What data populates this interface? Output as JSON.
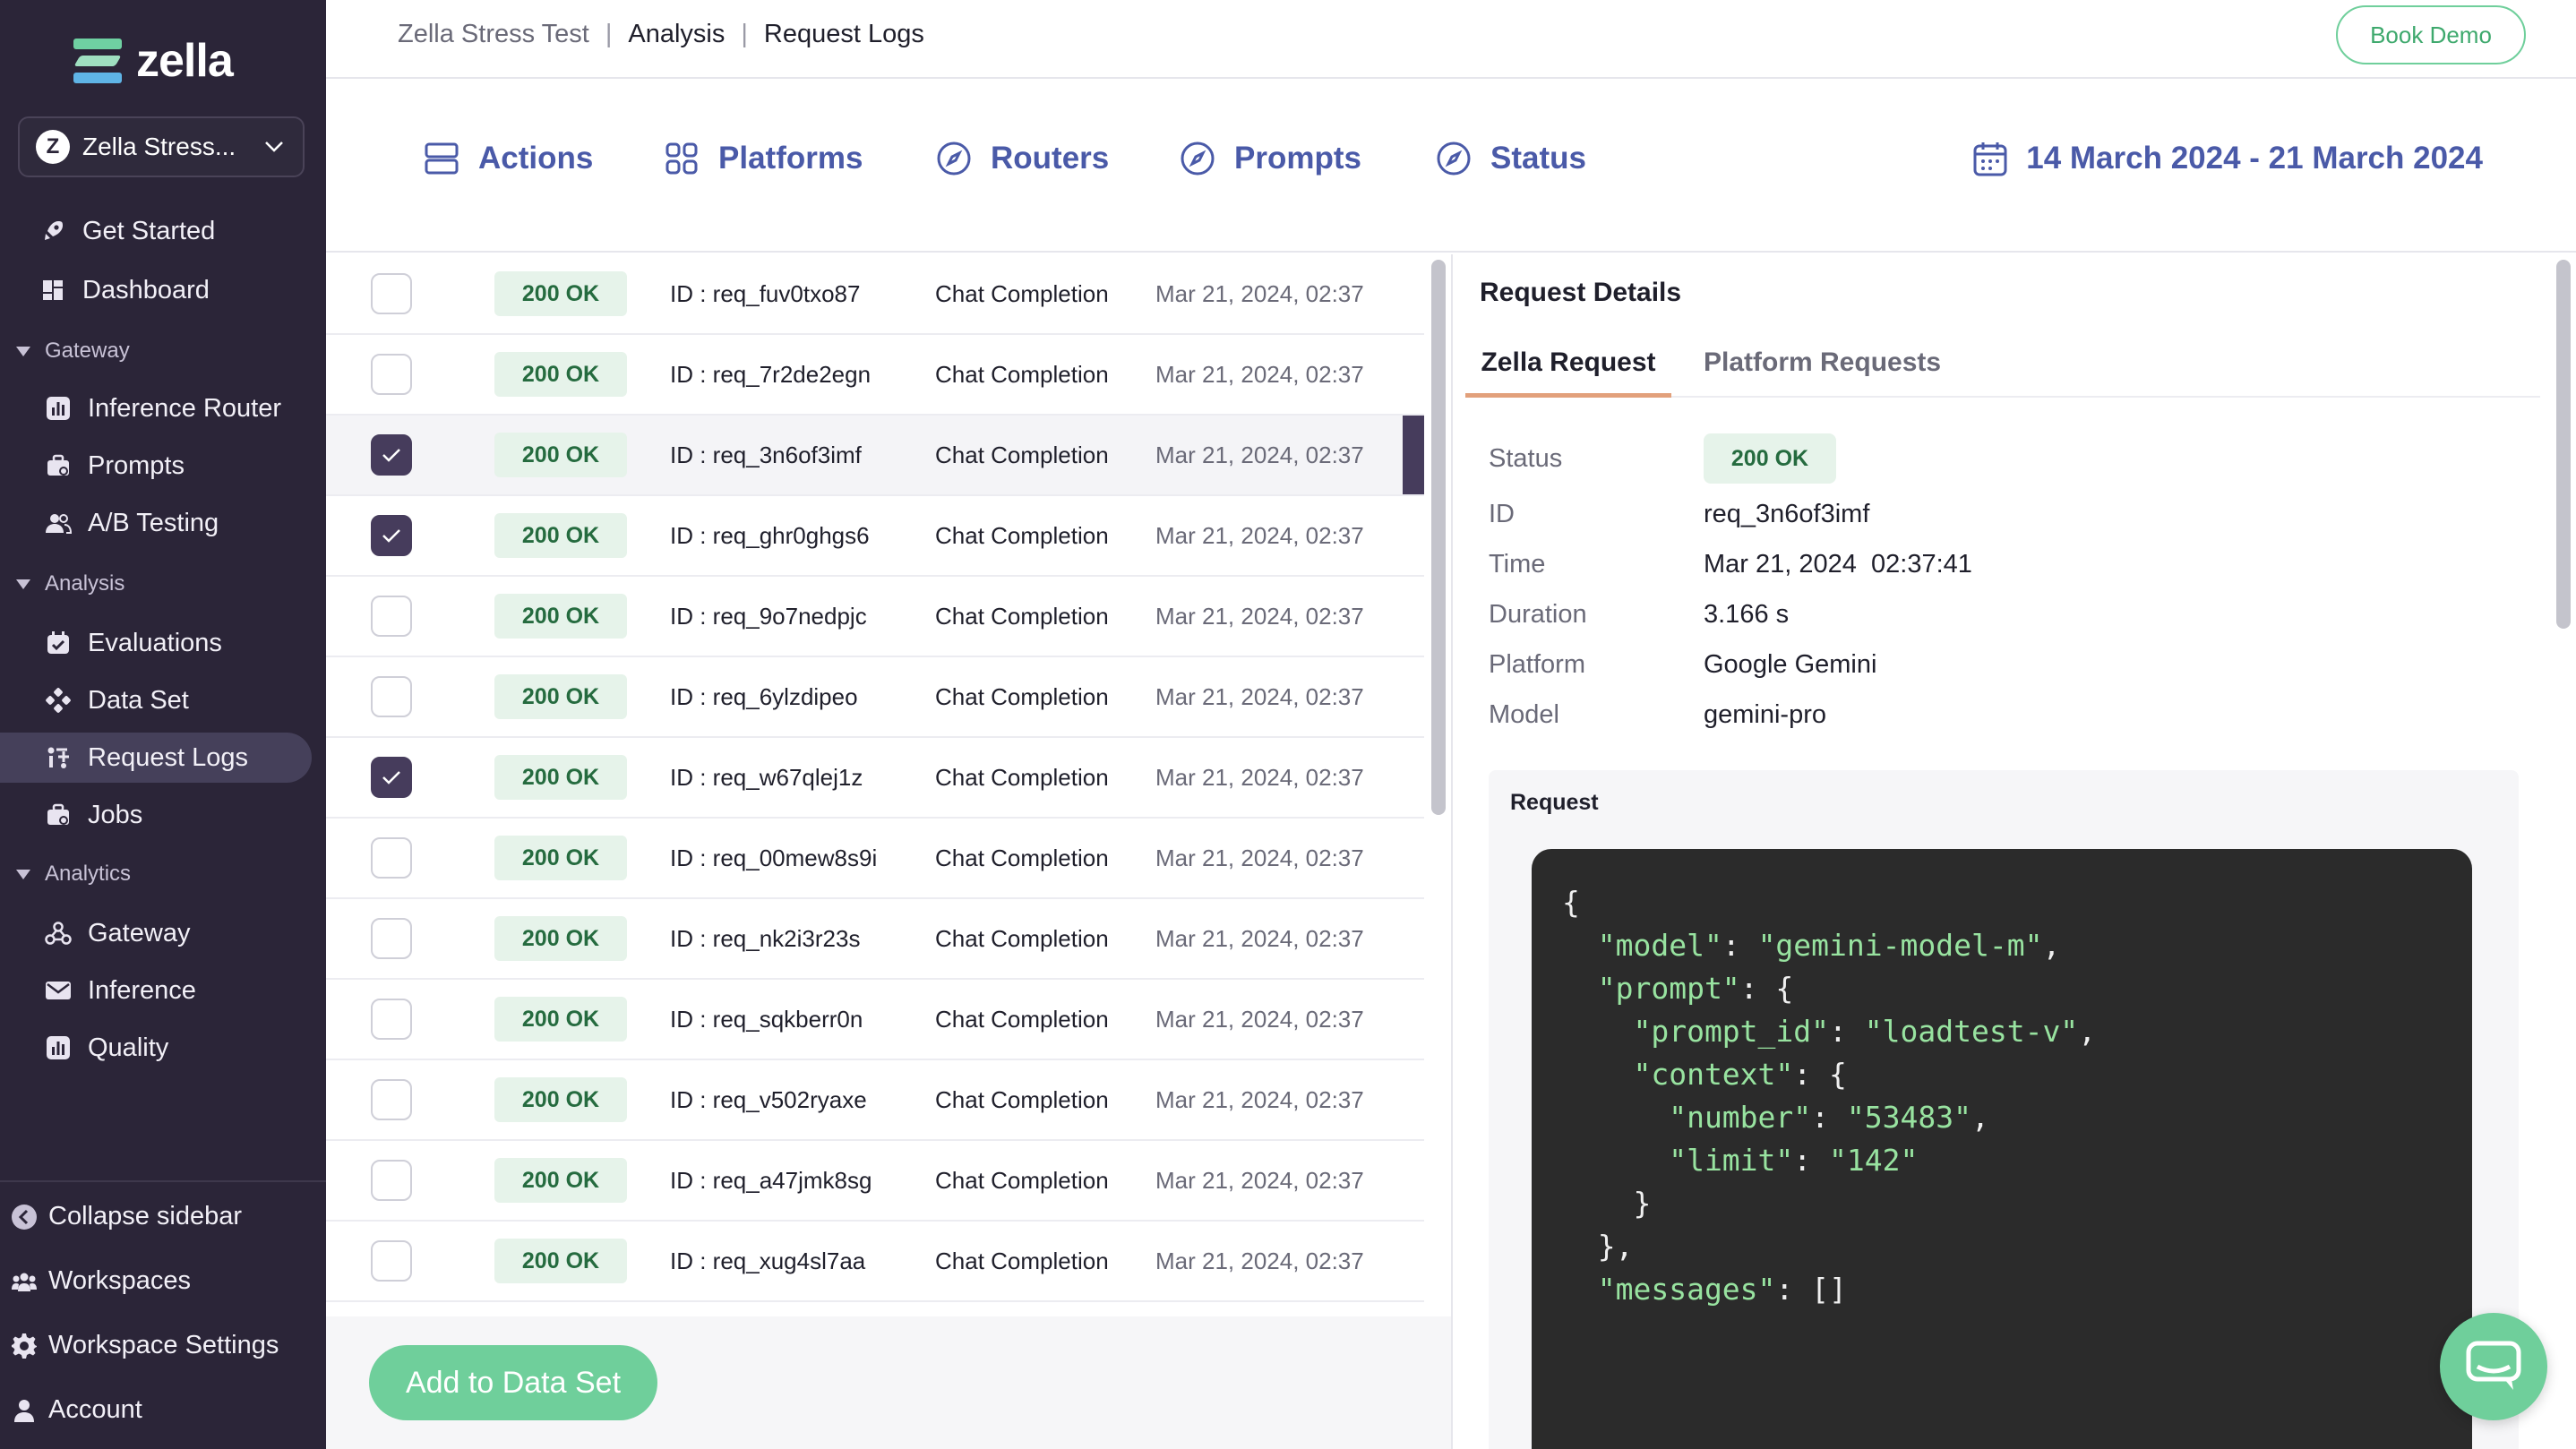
{
  "brand": {
    "name": "zella"
  },
  "workspace": {
    "initial": "Z",
    "name": "Zella Stress..."
  },
  "sidebar": {
    "top_items": [
      {
        "label": "Get Started",
        "icon": "rocket-icon"
      },
      {
        "label": "Dashboard",
        "icon": "dashboard-icon"
      }
    ],
    "sections": [
      {
        "label": "Gateway",
        "items": [
          {
            "label": "Inference Router",
            "icon": "chart-icon"
          },
          {
            "label": "Prompts",
            "icon": "briefcase-icon"
          },
          {
            "label": "A/B Testing",
            "icon": "users-icon"
          }
        ]
      },
      {
        "label": "Analysis",
        "items": [
          {
            "label": "Evaluations",
            "icon": "calendar-check-icon"
          },
          {
            "label": "Data Set",
            "icon": "nodes-icon"
          },
          {
            "label": "Request Logs",
            "icon": "logs-icon",
            "active": true
          },
          {
            "label": "Jobs",
            "icon": "briefcase-icon"
          }
        ]
      },
      {
        "label": "Analytics",
        "items": [
          {
            "label": "Gateway",
            "icon": "webhook-icon"
          },
          {
            "label": "Inference",
            "icon": "mail-icon"
          },
          {
            "label": "Quality",
            "icon": "chart-icon"
          }
        ]
      }
    ],
    "bottom_items": [
      {
        "label": "Collapse sidebar",
        "icon": "collapse-icon"
      },
      {
        "label": "Workspaces",
        "icon": "workspaces-icon"
      },
      {
        "label": "Workspace Settings",
        "icon": "gear-icon"
      },
      {
        "label": "Account",
        "icon": "user-icon"
      }
    ]
  },
  "breadcrumb": {
    "first": "Zella Stress Test",
    "second": "Analysis",
    "third": "Request Logs",
    "sep": "|"
  },
  "header": {
    "book_demo": "Book Demo"
  },
  "filters": {
    "actions": "Actions",
    "platforms": "Platforms",
    "routers": "Routers",
    "prompts": "Prompts",
    "status": "Status",
    "date_range": "14 March 2024 - 21 March 2024"
  },
  "rows": [
    {
      "status": "200 OK",
      "id": "ID : req_fuv0txo87",
      "type": "Chat Completion",
      "time": "Mar 21, 2024, 02:37",
      "checked": false
    },
    {
      "status": "200 OK",
      "id": "ID : req_7r2de2egn",
      "type": "Chat Completion",
      "time": "Mar 21, 2024, 02:37",
      "checked": false
    },
    {
      "status": "200 OK",
      "id": "ID : req_3n6of3imf",
      "type": "Chat Completion",
      "time": "Mar 21, 2024, 02:37",
      "checked": true,
      "selected": true
    },
    {
      "status": "200 OK",
      "id": "ID : req_ghr0ghgs6",
      "type": "Chat Completion",
      "time": "Mar 21, 2024, 02:37",
      "checked": true
    },
    {
      "status": "200 OK",
      "id": "ID : req_9o7nedpjc",
      "type": "Chat Completion",
      "time": "Mar 21, 2024, 02:37",
      "checked": false
    },
    {
      "status": "200 OK",
      "id": "ID : req_6ylzdipeo",
      "type": "Chat Completion",
      "time": "Mar 21, 2024, 02:37",
      "checked": false
    },
    {
      "status": "200 OK",
      "id": "ID : req_w67qlej1z",
      "type": "Chat Completion",
      "time": "Mar 21, 2024, 02:37",
      "checked": true
    },
    {
      "status": "200 OK",
      "id": "ID : req_00mew8s9i",
      "type": "Chat Completion",
      "time": "Mar 21, 2024, 02:37",
      "checked": false
    },
    {
      "status": "200 OK",
      "id": "ID : req_nk2i3r23s",
      "type": "Chat Completion",
      "time": "Mar 21, 2024, 02:37",
      "checked": false
    },
    {
      "status": "200 OK",
      "id": "ID : req_sqkberr0n",
      "type": "Chat Completion",
      "time": "Mar 21, 2024, 02:37",
      "checked": false
    },
    {
      "status": "200 OK",
      "id": "ID : req_v502ryaxe",
      "type": "Chat Completion",
      "time": "Mar 21, 2024, 02:37",
      "checked": false
    },
    {
      "status": "200 OK",
      "id": "ID : req_a47jmk8sg",
      "type": "Chat Completion",
      "time": "Mar 21, 2024, 02:37",
      "checked": false
    },
    {
      "status": "200 OK",
      "id": "ID : req_xug4sl7aa",
      "type": "Chat Completion",
      "time": "Mar 21, 2024, 02:37",
      "checked": false
    }
  ],
  "table_actions": {
    "add_to_dataset": "Add to Data Set"
  },
  "details": {
    "title": "Request Details",
    "tab_active": "Zella Request",
    "tab_inactive": "Platform Requests",
    "status_label": "Status",
    "status_value": "200 OK",
    "fields": [
      {
        "label": "ID",
        "value": "req_3n6of3imf"
      },
      {
        "label": "Time",
        "value": "Mar 21, 2024  02:37:41"
      },
      {
        "label": "Duration",
        "value": "3.166 s"
      },
      {
        "label": "Platform",
        "value": "Google Gemini"
      },
      {
        "label": "Model",
        "value": "gemini-pro"
      }
    ],
    "request_title": "Request",
    "code_lines": [
      [
        "p",
        "{"
      ],
      [
        "k",
        "  \"model\"",
        "p",
        ": ",
        "s",
        "\"gemini-model-m\"",
        "p",
        ","
      ],
      [
        "k",
        "  \"prompt\"",
        "p",
        ": {"
      ],
      [
        "k",
        "    \"prompt_id\"",
        "p",
        ": ",
        "s",
        "\"loadtest-v\"",
        "p",
        ","
      ],
      [
        "k",
        "    \"context\"",
        "p",
        ": {"
      ],
      [
        "k",
        "      \"number\"",
        "p",
        ": ",
        "s",
        "\"53483\"",
        "p",
        ","
      ],
      [
        "k",
        "      \"limit\"",
        "p",
        ": ",
        "s",
        "\"142\""
      ],
      [
        "p",
        "    }"
      ],
      [
        "p",
        "  },"
      ],
      [
        "k",
        "  \"messages\"",
        "p",
        ": []"
      ]
    ]
  },
  "colors": {
    "sidebar_bg": "#2b2538",
    "accent_green": "#6fcf9b",
    "filter_blue": "#4a5aa8",
    "status_green_bg": "#e6f3ea",
    "status_green_text": "#256b3f",
    "checkbox_dark": "#463c5c",
    "tab_underline": "#e2a07b"
  }
}
